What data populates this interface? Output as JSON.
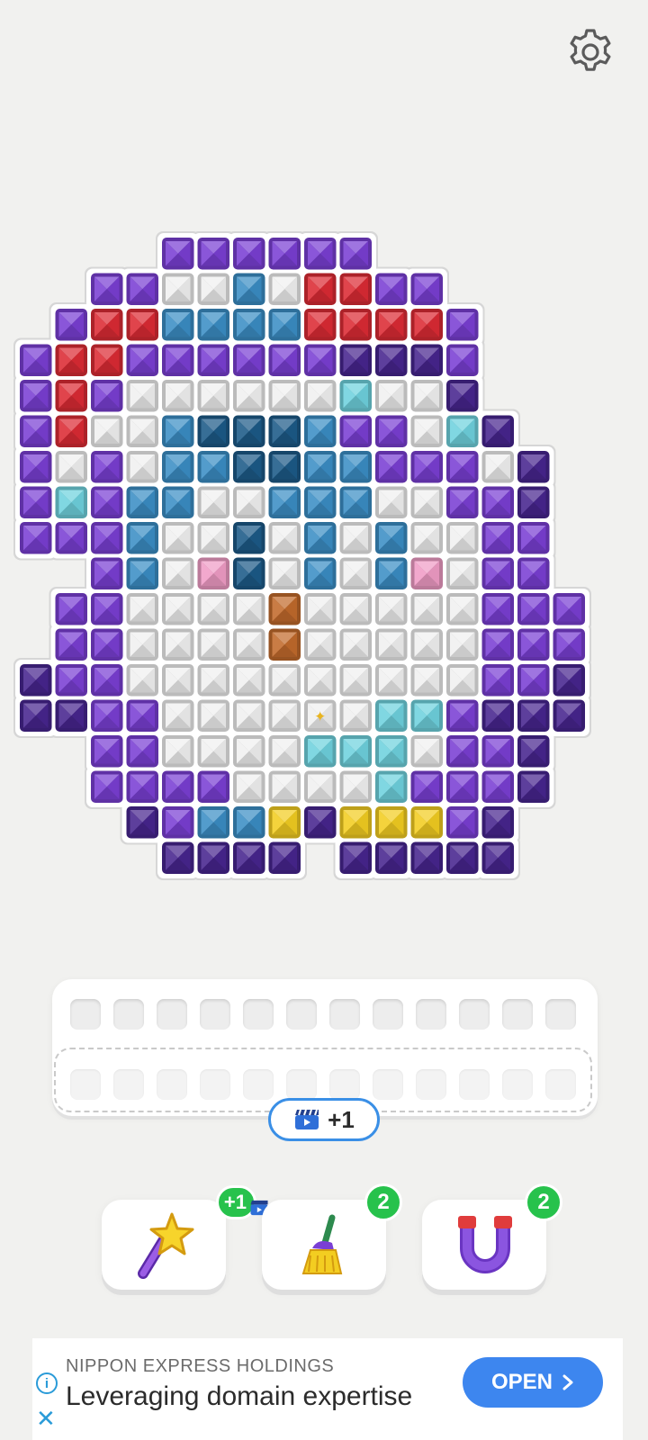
{
  "settings": {
    "icon": "gear-icon"
  },
  "colors": {
    "P": "#7a3fd4",
    "D": "#47258f",
    "R": "#dc2b34",
    "W": "#f0f0f0",
    "B": "#3b8ec5",
    "N": "#1c5a88",
    "C": "#6fd2de",
    "K": "#f09cc6",
    "O": "#c26a2c",
    "Y": "#f3cd21"
  },
  "board": {
    "rows": [
      "....PPPPPP......",
      "..PPWWBWRRPP....",
      ".PRRBBBBRRRRP...",
      "PRRPPPPPPDDDP...",
      "PRPWWWWWWCWWD...",
      "PRWWBNNNBPPWCD..",
      "PWPWBBNNBBPPPWD.",
      "PCPBBWWBBBWWPPD.",
      "PPPBWWNWBWBWWPP.",
      "..PBWKNWBWBKWPP.",
      ".PPWWWWOWWWWWPPP",
      ".PPWWWWOWWWWWPPP",
      "DPPWWWWWWWWWWPPD",
      "DDPPWWWWWWCCPDDD",
      "..PPWWWWCCCWPPD.",
      "..PPPPWWWWCPPPD.",
      "...DPBBYDYYYPD..",
      "....DDDD.DDDDD.."
    ],
    "highlight": {
      "row": 13,
      "col": 8,
      "marker": "✦"
    }
  },
  "tray": {
    "slots_per_row": 12,
    "extra_slot_label": "+1",
    "extra_slot_icon": "video-ad-icon"
  },
  "boosters": [
    {
      "name": "magic-wand",
      "icon": "magic-wand-icon",
      "badge": "+1",
      "badge_icon": "video-ad-icon"
    },
    {
      "name": "broom",
      "icon": "broom-icon",
      "badge": "2"
    },
    {
      "name": "magnet",
      "icon": "magnet-icon",
      "badge": "2"
    }
  ],
  "ad": {
    "brand": "NIPPON EXPRESS HOLDINGS",
    "headline": "Leveraging domain expertise",
    "cta": "OPEN",
    "info_icon": "info-icon",
    "close_icon": "close-icon"
  }
}
